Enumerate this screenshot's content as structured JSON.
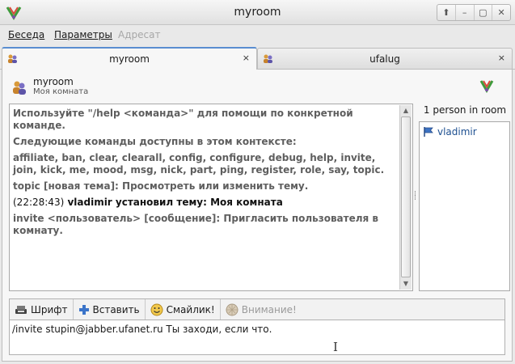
{
  "window": {
    "title": "myroom",
    "controls": [
      "⬆",
      "–",
      "▢",
      "✕"
    ]
  },
  "menu": {
    "items": [
      {
        "label": "Беседа",
        "disabled": false
      },
      {
        "label": "Параметры",
        "disabled": false
      },
      {
        "label": "Адресат",
        "disabled": true
      }
    ]
  },
  "tabs": [
    {
      "label": "myroom",
      "close": "×",
      "active": true,
      "icon": "group-chat-icon"
    },
    {
      "label": "ufalug",
      "close": "×",
      "active": false,
      "icon": "group-chat-icon"
    }
  ],
  "room": {
    "name": "myroom",
    "subject": "Моя комната"
  },
  "log": [
    {
      "text": "Используйте \"/help <команда>\" для помощи по конкретной команде.",
      "style": "muted"
    },
    {
      "text": "Следующие команды доступны в этом контексте:",
      "style": "muted"
    },
    {
      "text": "affiliate, ban, clear, clearall, config, configure, debug, help, invite, join, kick, me, mood, msg, nick, part, ping, register, role, say, topic.",
      "style": "muted"
    },
    {
      "text": "topic [новая тема]:  Просмотреть или изменить тему.",
      "style": "muted"
    },
    {
      "time": "(22:28:43)",
      "text": "vladimir установил тему: Моя комната",
      "style": "strong"
    },
    {
      "text": "invite <пользователь> [сообщение]:  Пригласить пользователя в комнату.",
      "style": "muted"
    }
  ],
  "roster": {
    "caption": "1 person in room",
    "members": [
      {
        "name": "vladimir",
        "icon": "flag-icon"
      }
    ]
  },
  "toolbar": {
    "font_label": "Шрифт",
    "insert_label": "Вставить",
    "smiley_label": "Смайлик!",
    "attention_label": "Внимание!"
  },
  "input": {
    "value": "/invite stupin@jabber.ufanet.ru Ты заходи, если что."
  },
  "colors": {
    "accent": "#5a8ed0",
    "link": "#1d4f90"
  }
}
